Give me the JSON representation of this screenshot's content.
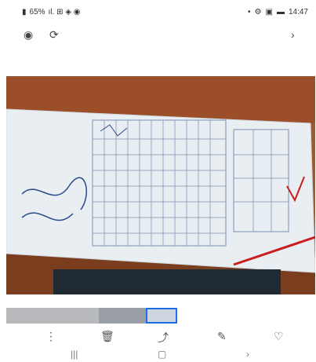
{
  "status_bar": {
    "battery_percent": "65%",
    "time": "14:47"
  },
  "viewer_toolbar": {
    "eye_icon": "eye-icon",
    "rotate_view_icon": "rotate-view-icon",
    "next_icon": "chevron-right-icon"
  },
  "actions": {
    "more_icon": "more-vertical-icon",
    "delete_icon": "trash-icon",
    "share_icon": "share-icon",
    "edit_icon": "pencil-icon",
    "favorite_icon": "heart-icon"
  },
  "nav_bar": {
    "recents_icon": "recents-icon",
    "home_icon": "home-icon",
    "back_icon": "back-chevron-icon"
  },
  "colors": {
    "desk": "#a0522d",
    "paper": "#e9eef2",
    "ink": "#2b4a8a",
    "red_mark": "#c81e1e"
  }
}
